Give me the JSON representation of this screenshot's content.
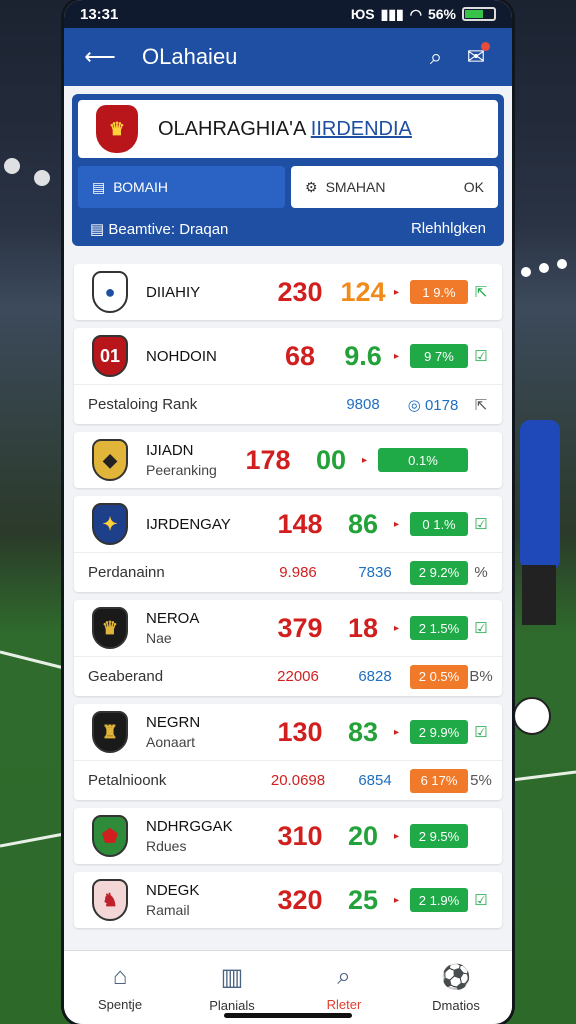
{
  "status": {
    "time": "13:31",
    "network": "ЮS",
    "battery": "56%"
  },
  "appbar": {
    "title": "OLahaieu",
    "back_icon": "arrow-left-icon",
    "search_icon": "search-icon",
    "notify_icon": "notification-icon"
  },
  "hero": {
    "title_a": "OLAHRAGHIA'A",
    "title_b": "IIRDENDIA",
    "seg_left": "ВОМАІН",
    "seg_right_label": "SMAHAN",
    "seg_right_value": "OK",
    "foot_left": "Beamtive: Draqan",
    "foot_right": "Rlehhlgken"
  },
  "rows": [
    {
      "name": "DIIAHIY",
      "sub": "",
      "v1": "230",
      "v2": "124",
      "v2color": "#f08a1a",
      "pill": "1 9.%",
      "pillcolor": "orange",
      "side": "⇱",
      "crest_bg": "#ffffff",
      "crest_fg": "#1e4fa3",
      "crest_char": "●"
    },
    {
      "name": "NOHDOIN",
      "sub": "",
      "v1": "68",
      "v2": "9.6",
      "v2color": "#23a23a",
      "pill": "9 7%",
      "pillcolor": "green",
      "side": "☑",
      "crest_bg": "#b8161b",
      "crest_fg": "#fff",
      "crest_char": "01",
      "detail": {
        "label": "Pestaloing Rank",
        "m1": "",
        "m2": "9808",
        "m3": "◎ 0178",
        "pill": "",
        "side": "⇱"
      }
    },
    {
      "name": "IJIADN",
      "sub": "Peeranking",
      "v1": "178",
      "v2": "00",
      "v2color": "#23a23a",
      "pill": "0.1%",
      "pillcolor": "green",
      "wide": true,
      "side": "",
      "crest_bg": "#e0b53a",
      "crest_fg": "#222",
      "crest_char": "◆"
    },
    {
      "name": "IJRDENGAY",
      "sub": "",
      "v1": "148",
      "v2": "86",
      "v2color": "#23a23a",
      "pill": "0 1.%",
      "pillcolor": "green",
      "side": "☑",
      "crest_bg": "#1e3f8a",
      "crest_fg": "#ffd23a",
      "crest_char": "✦",
      "detail": {
        "label": "Perdanainn",
        "m1": "9.986",
        "m2": "7836",
        "pill": "2 9.2%",
        "pillcolor": "green",
        "side": "%"
      }
    },
    {
      "name": "NEROA",
      "sub": "Nae",
      "v1": "379",
      "v2": "18",
      "v2color": "#d11f1f",
      "pill": "2 1.5%",
      "pillcolor": "green",
      "side": "☑",
      "crest_bg": "#1a1a1a",
      "crest_fg": "#e0b53a",
      "crest_char": "♛",
      "detail": {
        "label": "Geaberand",
        "m1": "22006",
        "m2": "6828",
        "pill": "2 0.5%",
        "pillcolor": "orange",
        "side": "B%"
      }
    },
    {
      "name": "NEGRN",
      "sub": "Aonaart",
      "v1": "130",
      "v2": "83",
      "v2color": "#23a23a",
      "pill": "2 9.9%",
      "pillcolor": "green",
      "side": "☑",
      "crest_bg": "#1a1a1a",
      "crest_fg": "#e0b53a",
      "crest_char": "♜",
      "detail": {
        "label": "Petalnioonk",
        "m1": "20.0698",
        "m2": "6854",
        "pill": "6 17%",
        "pillcolor": "orange",
        "side": "5%"
      }
    },
    {
      "name": "NDHRGGAK",
      "sub": "Rdues",
      "v1": "310",
      "v2": "20",
      "v2color": "#23a23a",
      "pill": "2 9.5%",
      "pillcolor": "green",
      "side": "",
      "crest_bg": "#2e8b3a",
      "crest_fg": "#d11f1f",
      "crest_char": "⬟"
    },
    {
      "name": "NDEGK",
      "sub": "Ramail",
      "v1": "320",
      "v2": "25",
      "v2color": "#23a23a",
      "pill": "2 1.9%",
      "pillcolor": "green",
      "side": "☑",
      "crest_bg": "#f3d6d6",
      "crest_fg": "#c0202a",
      "crest_char": "♞"
    }
  ],
  "nav": [
    {
      "label": "Spentje",
      "icon": "home-icon"
    },
    {
      "label": "Planials",
      "icon": "building-icon"
    },
    {
      "label": "Rleter",
      "icon": "search-user-icon"
    },
    {
      "label": "Dmatios",
      "icon": "player-icon"
    }
  ],
  "colors": {
    "primary": "#1e4fa3",
    "accent_red": "#d11f1f",
    "accent_green": "#23a23a",
    "accent_orange": "#f07a2a"
  }
}
